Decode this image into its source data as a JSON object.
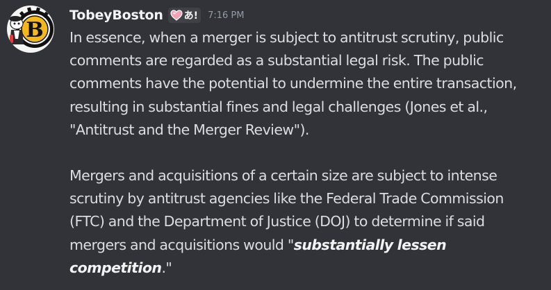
{
  "message": {
    "username": "TobeyBoston",
    "tag": "あ!",
    "timestamp": "7:16 PM",
    "paragraph1": "In essence, when a merger is subject to antitrust scrutiny, public comments are regarded as a substantial legal risk. The public comments have the potential to undermine the entire transaction, resulting in substantial fines and legal challenges (Jones et al., \"Antitrust and the Merger Review\").",
    "paragraph2_lead": "Mergers and acquisitions of a certain size are subject to intense scrutiny by antitrust agencies like the Federal Trade Commission (FTC) and the Department of Justice (DOJ) to determine if said mergers and acquisitions would \"",
    "paragraph2_emphasis": "substantially lessen competition",
    "paragraph2_tail": ".\""
  },
  "icons": {
    "avatar": "boston-bruins-logo",
    "tag_icon": "heart-icon"
  },
  "colors": {
    "background": "#313338",
    "username": "#f2f3f5",
    "text": "#dbdee1",
    "timestamp": "#949ba4",
    "tag_background": "#3f4147",
    "heart": "#f0a3b6"
  }
}
